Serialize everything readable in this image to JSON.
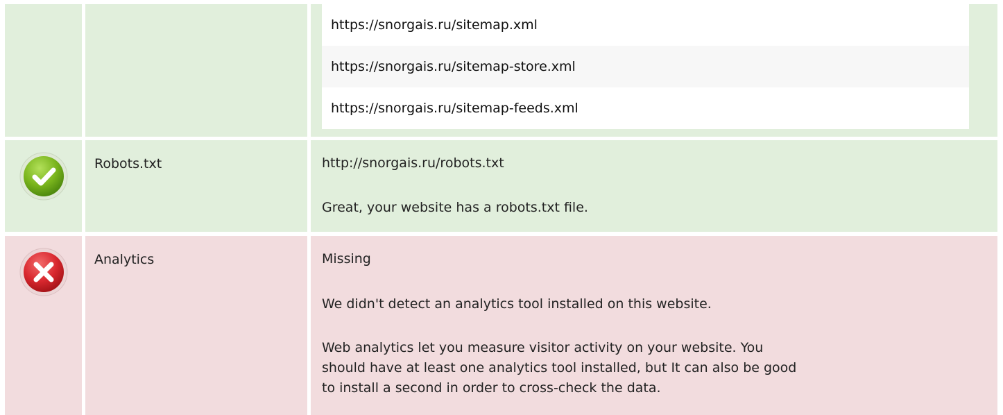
{
  "sitemaps": {
    "urls": [
      "https://snorgais.ru/sitemap.xml",
      "https://snorgais.ru/sitemap-store.xml",
      "https://snorgais.ru/sitemap-feeds.xml"
    ]
  },
  "robots": {
    "status_icon": "check-icon",
    "label": "Robots.txt",
    "url": "http://snorgais.ru/robots.txt",
    "message": "Great, your website has a robots.txt file."
  },
  "analytics": {
    "status_icon": "cross-icon",
    "label": "Analytics",
    "status": "Missing",
    "message": "We didn't detect an analytics tool installed on this website.",
    "advice": "Web analytics let you measure visitor activity on your website. You should have at least one analytics tool installed, but It can also be good to install a second in order to cross-check the data."
  },
  "colors": {
    "pass_bg": "#e1efdc",
    "fail_bg": "#f2dcde",
    "pass_icon": "#7ab51d",
    "fail_icon": "#d9282f"
  }
}
